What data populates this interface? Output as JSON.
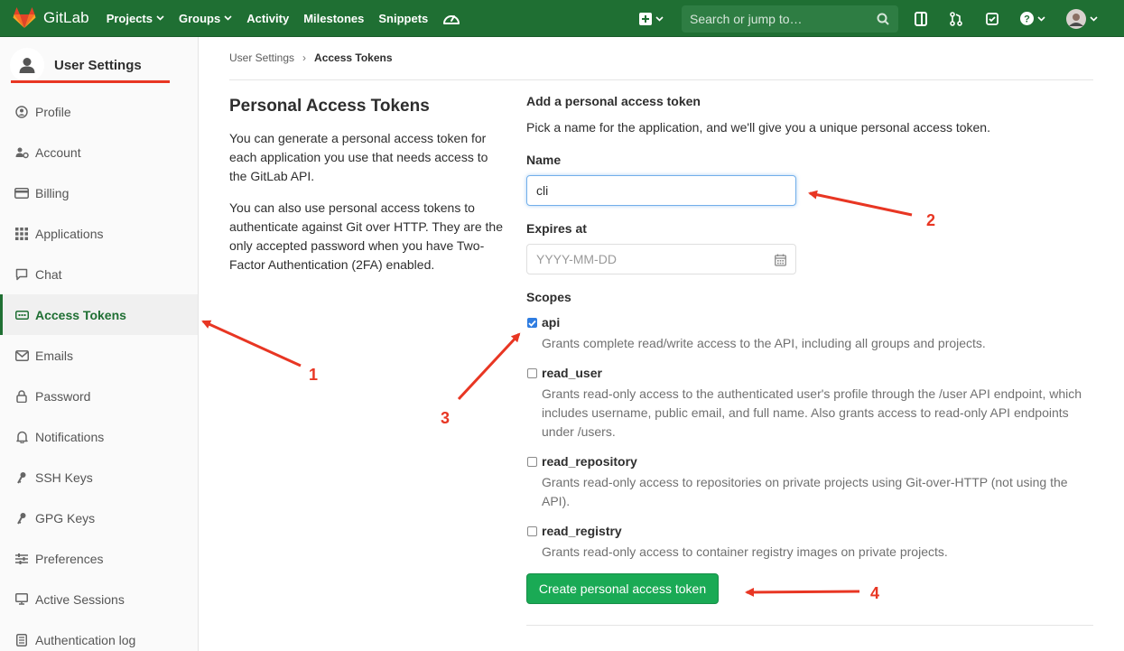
{
  "navbar": {
    "brand": "GitLab",
    "links": [
      "Projects",
      "Groups",
      "Activity",
      "Milestones",
      "Snippets"
    ],
    "search_placeholder": "Search or jump to…"
  },
  "sidebar": {
    "title": "User Settings",
    "items": [
      {
        "label": "Profile",
        "icon": "profile-icon"
      },
      {
        "label": "Account",
        "icon": "account-icon"
      },
      {
        "label": "Billing",
        "icon": "billing-icon"
      },
      {
        "label": "Applications",
        "icon": "applications-icon"
      },
      {
        "label": "Chat",
        "icon": "chat-icon"
      },
      {
        "label": "Access Tokens",
        "icon": "access-tokens-icon",
        "active": true
      },
      {
        "label": "Emails",
        "icon": "email-icon"
      },
      {
        "label": "Password",
        "icon": "lock-icon"
      },
      {
        "label": "Notifications",
        "icon": "bell-icon"
      },
      {
        "label": "SSH Keys",
        "icon": "key-icon"
      },
      {
        "label": "GPG Keys",
        "icon": "key-icon"
      },
      {
        "label": "Preferences",
        "icon": "preferences-icon"
      },
      {
        "label": "Active Sessions",
        "icon": "monitor-icon"
      },
      {
        "label": "Authentication log",
        "icon": "log-icon"
      }
    ]
  },
  "breadcrumb": {
    "parent": "User Settings",
    "separator": "›",
    "current": "Access Tokens"
  },
  "intro": {
    "title": "Personal Access Tokens",
    "para1": "You can generate a personal access token for each application you use that needs access to the GitLab API.",
    "para2": "You can also use personal access tokens to authenticate against Git over HTTP. They are the only accepted password when you have Two-Factor Authentication (2FA) enabled."
  },
  "form": {
    "heading": "Add a personal access token",
    "subheading": "Pick a name for the application, and we'll give you a unique personal access token.",
    "name_label": "Name",
    "name_value": "cli",
    "expires_label": "Expires at",
    "expires_placeholder": "YYYY-MM-DD",
    "scopes_label": "Scopes",
    "scopes": [
      {
        "name": "api",
        "checked": true,
        "desc": "Grants complete read/write access to the API, including all groups and projects."
      },
      {
        "name": "read_user",
        "checked": false,
        "desc": "Grants read-only access to the authenticated user's profile through the /user API endpoint, which includes username, public email, and full name. Also grants access to read-only API endpoints under /users."
      },
      {
        "name": "read_repository",
        "checked": false,
        "desc": "Grants read-only access to repositories on private projects using Git-over-HTTP (not using the API)."
      },
      {
        "name": "read_registry",
        "checked": false,
        "desc": "Grants read-only access to container registry images on private projects."
      }
    ],
    "submit_label": "Create personal access token"
  },
  "annotations": {
    "color": "#e83623",
    "labels": [
      "1",
      "2",
      "3",
      "4"
    ]
  },
  "colors": {
    "navbar": "#1f6f33",
    "primary_button": "#1aaa55",
    "active_nav": "#1f6f33"
  }
}
